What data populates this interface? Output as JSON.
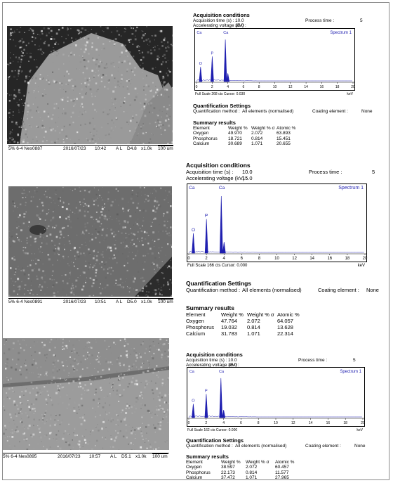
{
  "panels": [
    {
      "sem": {
        "sample_id": "5% 6-4 Nes0887",
        "date": "2016/07/23",
        "time": "10:42",
        "mode": "A L",
        "wd": "D4.8",
        "mag": "x1.0k",
        "scale": "100 um"
      },
      "acq_title": "Acquisition conditions",
      "acq_time_label": "Acquisition time (s) :",
      "acq_time_value": "10.0",
      "process_label": "Process time :",
      "process_value": "5",
      "voltage_label": "Accelerating voltage (kV) :",
      "voltage_value": "15.0",
      "spectrum_label": "Spectrum 1",
      "full_scale": "Full Scale 268 cts Cursor: 0.030",
      "kev": "keV",
      "peak_labels": [
        "Ca",
        "P",
        "Ca",
        "O"
      ],
      "x_ticks": [
        "0",
        "2",
        "4",
        "6",
        "8",
        "10",
        "12",
        "14",
        "16",
        "18",
        "20"
      ],
      "quant_title": "Quantification Settings",
      "quant_method_label": "Quantification method :",
      "quant_method_value": "All elements (normalised)",
      "coating_label": "Coating element :",
      "coating_value": "None",
      "summary_title": "Summary results",
      "headers": [
        "Element",
        "Weight %",
        "Weight % σ",
        "Atomic %"
      ],
      "rows": [
        [
          "Oxygen",
          "49.970",
          "2.072",
          "63.893"
        ],
        [
          "Phosphorus",
          "18.721",
          "0.814",
          "15.451"
        ],
        [
          "Calcium",
          "30.689",
          "1.071",
          "20.655"
        ]
      ]
    },
    {
      "sem": {
        "sample_id": "5% 6-4 Nes0891",
        "date": "2016/07/23",
        "time": "10:51",
        "mode": "A L",
        "wd": "D5.0",
        "mag": "x1.0k",
        "scale": "100 um"
      },
      "acq_title": "Acquisition conditions",
      "acq_time_label": "Acquisition time (s) :",
      "acq_time_value": "10.0",
      "process_label": "Process time :",
      "process_value": "5",
      "voltage_label": "Accelerating voltage (kV) :",
      "voltage_value": "15.0",
      "spectrum_label": "Spectrum 1",
      "full_scale": "Full Scale 166 cts Cursor: 0.000",
      "kev": "keV",
      "peak_labels": [
        "Ca",
        "P",
        "Ca",
        "O"
      ],
      "x_ticks": [
        "0",
        "2",
        "4",
        "6",
        "8",
        "10",
        "12",
        "14",
        "16",
        "18",
        "20"
      ],
      "quant_title": "Quantification Settings",
      "quant_method_label": "Quantification method :",
      "quant_method_value": "All elements (normalised)",
      "coating_label": "Coating element :",
      "coating_value": "None",
      "summary_title": "Summary results",
      "headers": [
        "Element",
        "Weight %",
        "Weight % σ",
        "Atomic %"
      ],
      "rows": [
        [
          "Oxygen",
          "47.764",
          "2.072",
          "64.057"
        ],
        [
          "Phosphorus",
          "19.032",
          "0.814",
          "13.628"
        ],
        [
          "Calcium",
          "31.783",
          "1.071",
          "22.314"
        ]
      ]
    },
    {
      "sem": {
        "sample_id": "5% 6-4 Nes0895",
        "date": "2016/07/23",
        "time": "10:57",
        "mode": "A L",
        "wd": "D5.1",
        "mag": "x1.0k",
        "scale": "100 um"
      },
      "acq_title": "Acquisition conditions",
      "acq_time_label": "Acquisition time (s) :",
      "acq_time_value": "10.0",
      "process_label": "Process time :",
      "process_value": "5",
      "voltage_label": "Accelerating voltage (kV) :",
      "voltage_value": "15.0",
      "spectrum_label": "Spectrum 1",
      "full_scale": "Full Scale 162 cts Cursor: 0.000",
      "kev": "keV",
      "peak_labels": [
        "Ca",
        "P",
        "Ca",
        "O"
      ],
      "x_ticks": [
        "0",
        "2",
        "4",
        "6",
        "8",
        "10",
        "12",
        "14",
        "16",
        "18",
        "20"
      ],
      "quant_title": "Quantification Settings",
      "quant_method_label": "Quantification method :",
      "quant_method_value": "All elements (normalised)",
      "coating_label": "Coating element :",
      "coating_value": "None",
      "summary_title": "Summary results",
      "headers": [
        "Element",
        "Weight %",
        "Weight % σ",
        "Atomic %"
      ],
      "rows": [
        [
          "Oxygen",
          "38.597",
          "2.072",
          "60.457"
        ],
        [
          "Phosphorus",
          "22.173",
          "0.814",
          "11.577"
        ],
        [
          "Calcium",
          "37.472",
          "1.071",
          "27.965"
        ]
      ]
    }
  ],
  "colors": {
    "spectrum": "#1f1fb0",
    "frame": "#8a8a8a",
    "sem_bg": "#505050"
  }
}
